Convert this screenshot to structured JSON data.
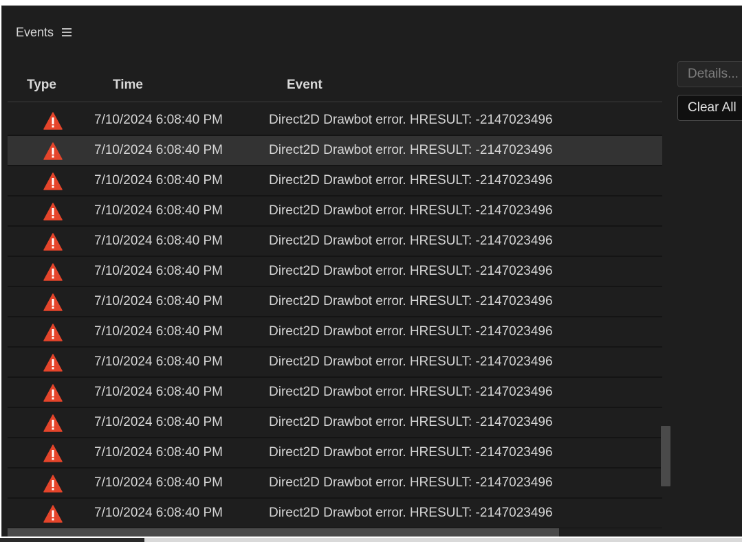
{
  "panel": {
    "title": "Events",
    "menu_icon": "hamburger-menu-icon"
  },
  "columns": {
    "type": "Type",
    "time": "Time",
    "event": "Event"
  },
  "buttons": {
    "details": "Details...",
    "clear_all": "Clear All"
  },
  "rows": [
    {
      "icon": "warning-icon",
      "time": "7/10/2024 6:08:40 PM",
      "event": "Direct2D Drawbot error. HRESULT: -2147023496",
      "selected": false
    },
    {
      "icon": "warning-icon",
      "time": "7/10/2024 6:08:40 PM",
      "event": "Direct2D Drawbot error. HRESULT: -2147023496",
      "selected": true
    },
    {
      "icon": "warning-icon",
      "time": "7/10/2024 6:08:40 PM",
      "event": "Direct2D Drawbot error. HRESULT: -2147023496",
      "selected": false
    },
    {
      "icon": "warning-icon",
      "time": "7/10/2024 6:08:40 PM",
      "event": "Direct2D Drawbot error. HRESULT: -2147023496",
      "selected": false
    },
    {
      "icon": "warning-icon",
      "time": "7/10/2024 6:08:40 PM",
      "event": "Direct2D Drawbot error. HRESULT: -2147023496",
      "selected": false
    },
    {
      "icon": "warning-icon",
      "time": "7/10/2024 6:08:40 PM",
      "event": "Direct2D Drawbot error. HRESULT: -2147023496",
      "selected": false
    },
    {
      "icon": "warning-icon",
      "time": "7/10/2024 6:08:40 PM",
      "event": "Direct2D Drawbot error. HRESULT: -2147023496",
      "selected": false
    },
    {
      "icon": "warning-icon",
      "time": "7/10/2024 6:08:40 PM",
      "event": "Direct2D Drawbot error. HRESULT: -2147023496",
      "selected": false
    },
    {
      "icon": "warning-icon",
      "time": "7/10/2024 6:08:40 PM",
      "event": "Direct2D Drawbot error. HRESULT: -2147023496",
      "selected": false
    },
    {
      "icon": "warning-icon",
      "time": "7/10/2024 6:08:40 PM",
      "event": "Direct2D Drawbot error. HRESULT: -2147023496",
      "selected": false
    },
    {
      "icon": "warning-icon",
      "time": "7/10/2024 6:08:40 PM",
      "event": "Direct2D Drawbot error. HRESULT: -2147023496",
      "selected": false
    },
    {
      "icon": "warning-icon",
      "time": "7/10/2024 6:08:40 PM",
      "event": "Direct2D Drawbot error. HRESULT: -2147023496",
      "selected": false
    },
    {
      "icon": "warning-icon",
      "time": "7/10/2024 6:08:40 PM",
      "event": "Direct2D Drawbot error. HRESULT: -2147023496",
      "selected": false
    },
    {
      "icon": "warning-icon",
      "time": "7/10/2024 6:08:40 PM",
      "event": "Direct2D Drawbot error. HRESULT: -2147023496",
      "selected": false
    }
  ],
  "colors": {
    "background": "#1e1e1e",
    "selected_row": "#333333",
    "warning": "#e5452b",
    "text": "#d6d6d6"
  }
}
